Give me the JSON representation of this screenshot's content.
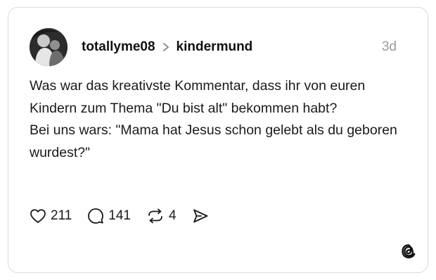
{
  "post": {
    "author": "totallyme08",
    "community": "kindermund",
    "age": "3d",
    "text_lines": [
      "Was war das kreativste Kommentar, dass ihr von euren Kindern zum Thema \"Du bist alt\" bekommen habt?",
      "Bei uns wars: \"Mama hat Jesus schon gelebt als du geboren wurdest?\""
    ]
  },
  "actions": {
    "likes": "211",
    "replies": "141",
    "reposts": "4"
  },
  "icons": {
    "like": "heart-icon",
    "reply": "comment-bubble-icon",
    "repost": "repost-arrows-icon",
    "share": "send-icon",
    "brand": "threads-logo-icon",
    "separator": "chevron-right-icon"
  }
}
